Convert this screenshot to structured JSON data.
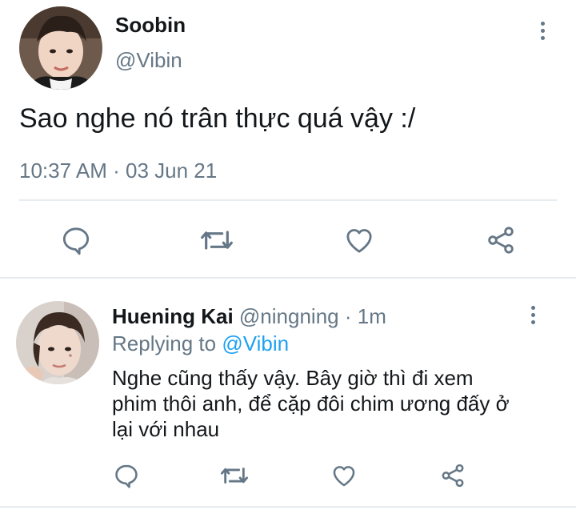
{
  "tweet": {
    "author_name": "Soobin",
    "author_handle": "@Vibin",
    "text": "Sao nghe nó trân thực quá vậy :/",
    "time": "10:37 AM",
    "separator": "·",
    "date": "03 Jun 21"
  },
  "reply": {
    "author_name": "Huening Kai",
    "author_handle": "@ningning",
    "separator": "·",
    "age": "1m",
    "replying_prefix": "Replying to",
    "replying_handle": "@Vibin",
    "text_line1": "Nghe cũng thấy vậy. Bây giờ thì đi xem",
    "text_line2": "phim thôi anh, để cặp đôi chim ương đấy ở",
    "text_line3": "lại với nhau"
  },
  "icons": {
    "reply": "reply-icon",
    "retweet": "retweet-icon",
    "like": "like-icon",
    "share": "share-icon",
    "more": "more-icon"
  },
  "colors": {
    "text": "#14171a",
    "secondary": "#657786",
    "link": "#1da1f2",
    "divider": "#e6ecf0"
  }
}
